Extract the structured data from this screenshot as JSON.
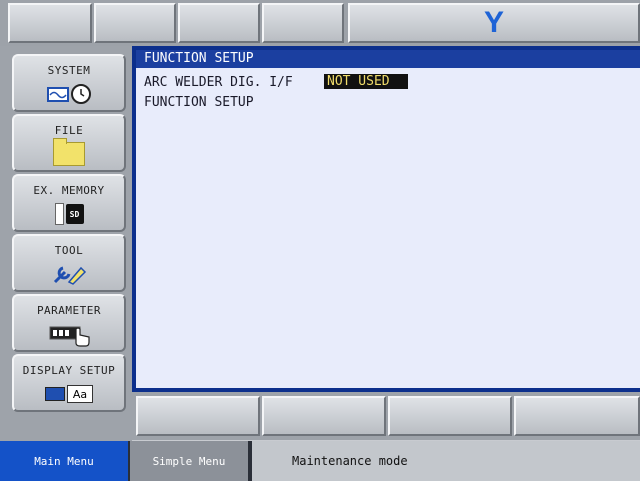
{
  "header": {
    "logo": "Y"
  },
  "sidebar": {
    "items": [
      {
        "label": "SYSTEM",
        "icon": "clock-icon"
      },
      {
        "label": "FILE",
        "icon": "folder-icon"
      },
      {
        "label": "EX. MEMORY",
        "icon": "sd-card-icon"
      },
      {
        "label": "TOOL",
        "icon": "tool-icon"
      },
      {
        "label": "PARAMETER",
        "icon": "parameter-icon"
      },
      {
        "label": "DISPLAY SETUP",
        "icon": "display-setup-icon"
      }
    ]
  },
  "main": {
    "title": "FUNCTION SETUP",
    "rows": [
      {
        "label": "ARC WELDER DIG. I/F",
        "value": "NOT USED"
      },
      {
        "label": "FUNCTION SETUP"
      }
    ]
  },
  "status": {
    "main_menu": "Main Menu",
    "simple_menu": "Simple Menu",
    "mode": "Maintenance mode"
  },
  "colors": {
    "accent": "#1452c8",
    "panel_bg": "#e8ecfb",
    "title_bg": "#1b3fa0",
    "value_fg": "#f0dc6a"
  }
}
